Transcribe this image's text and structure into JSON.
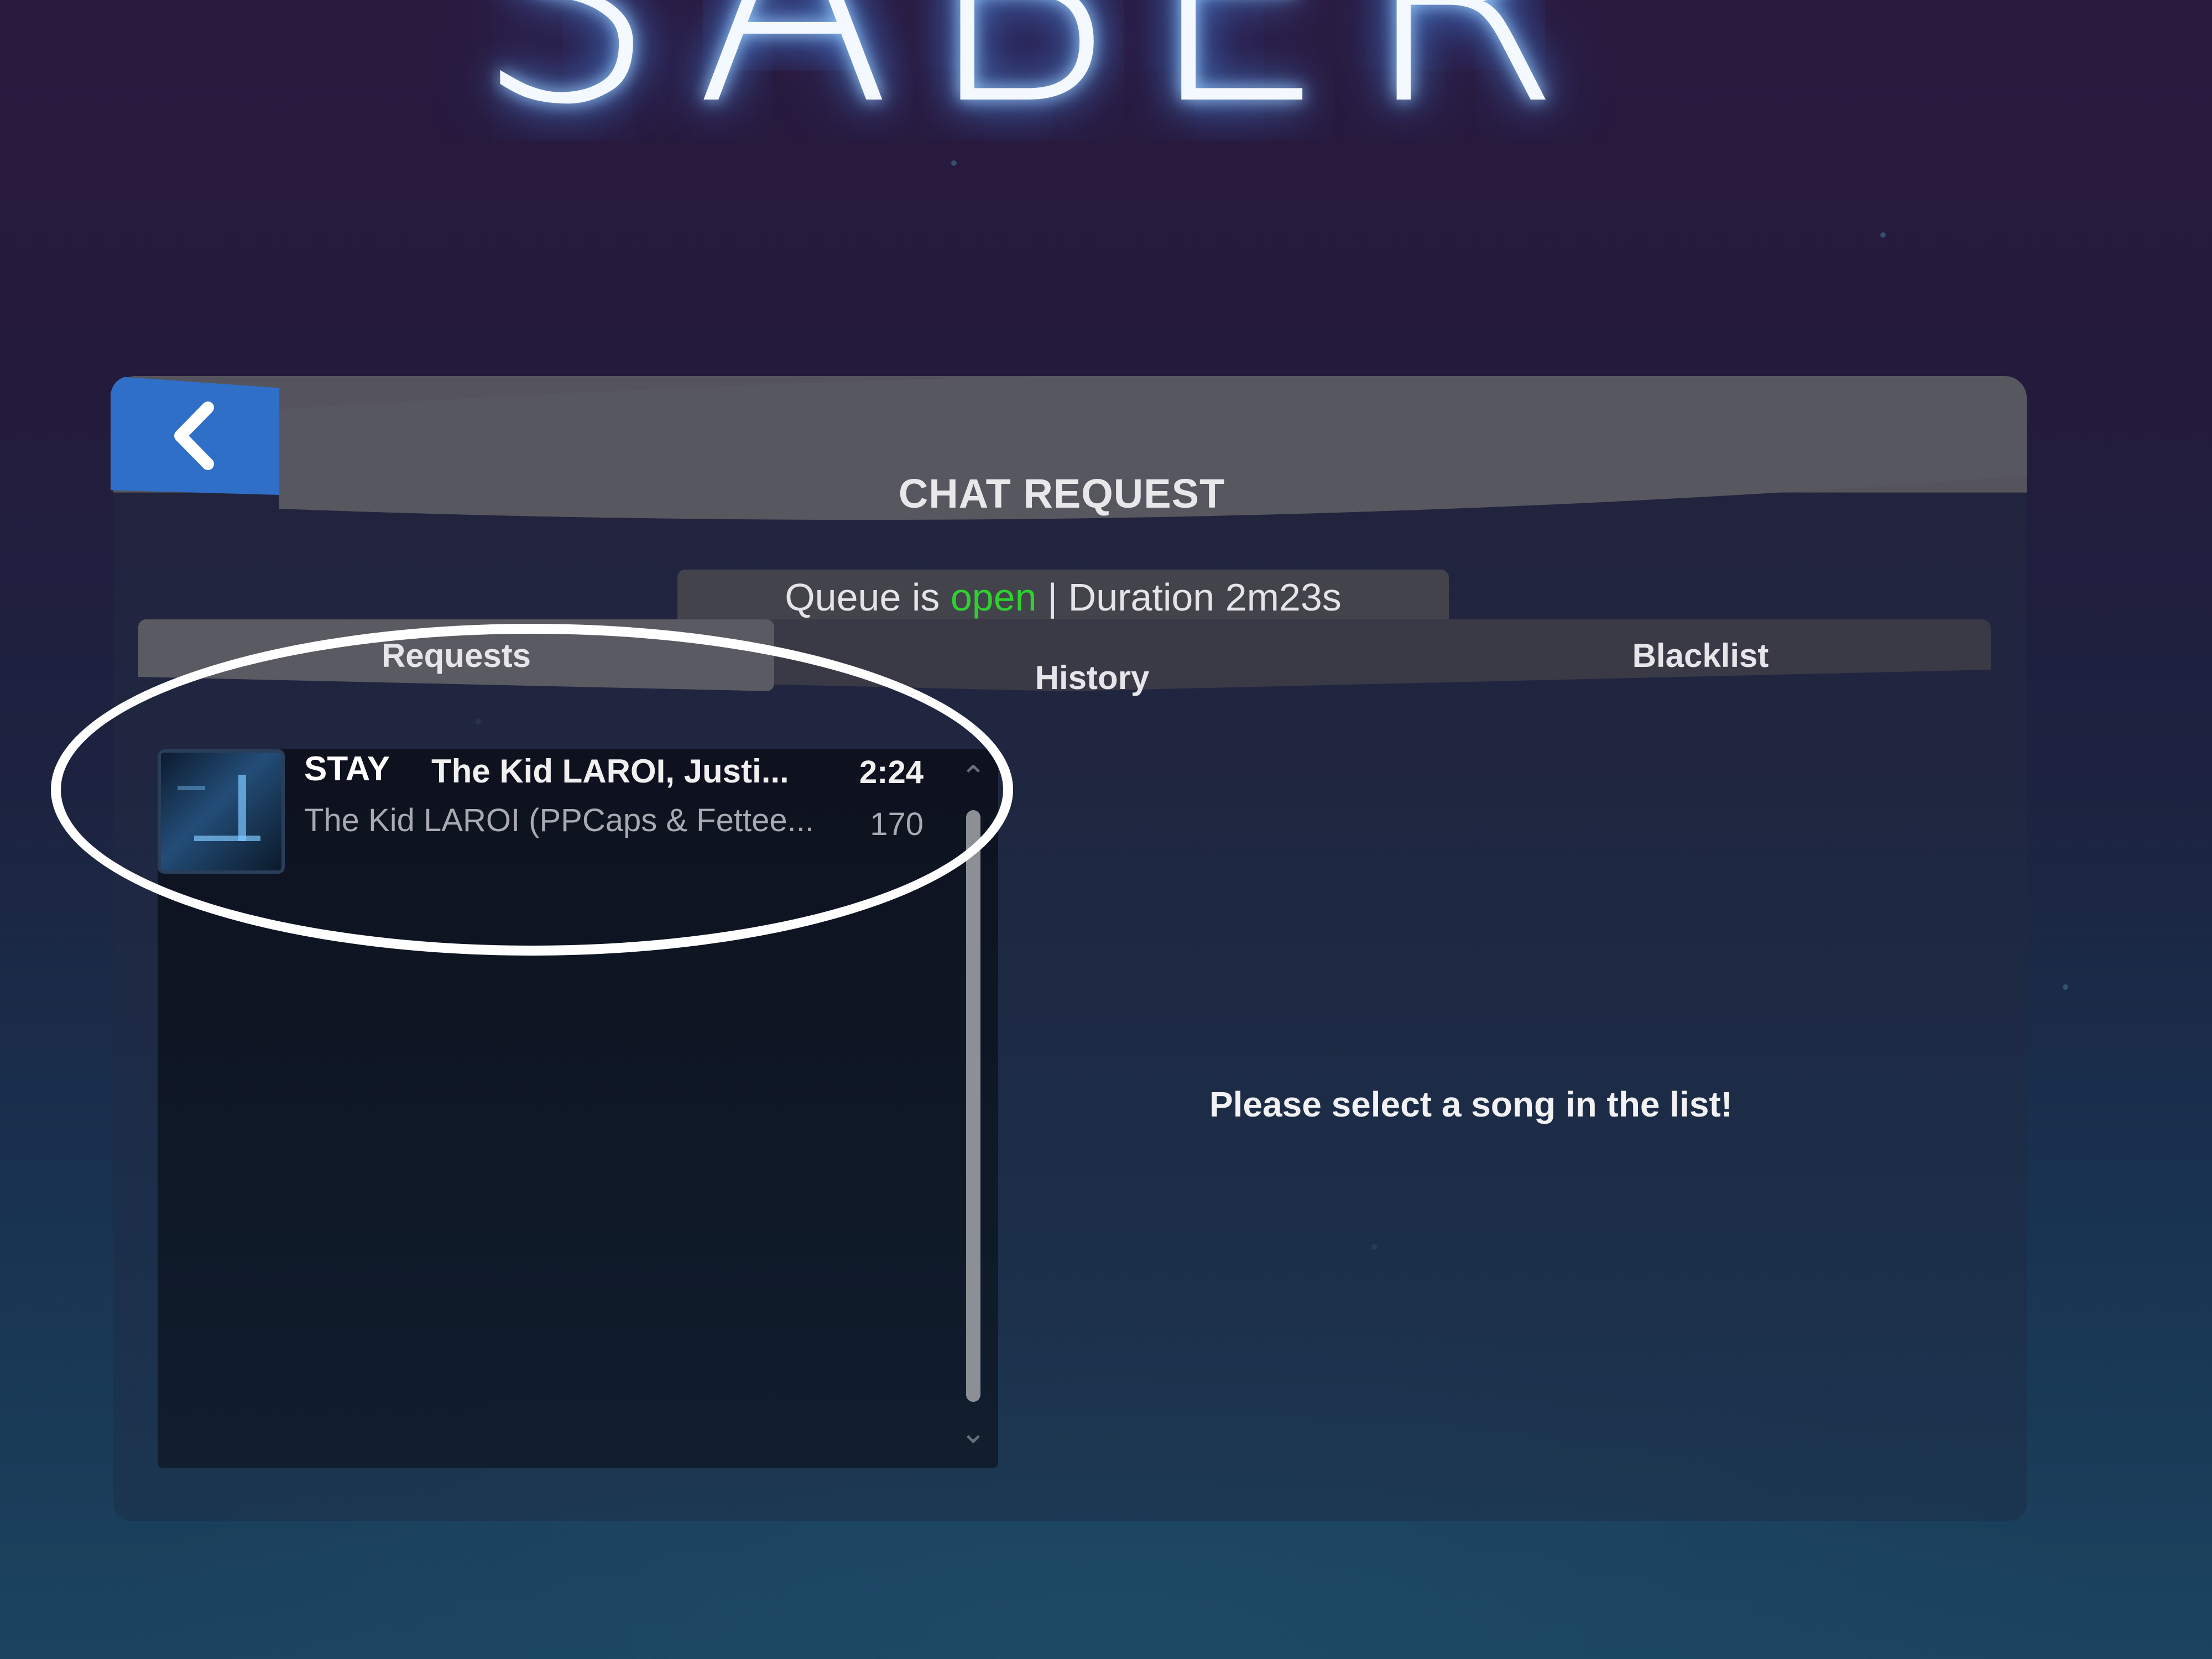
{
  "app": {
    "logo_text": "SABER"
  },
  "header": {
    "back_icon": "chevron-left-icon",
    "title": "CHAT REQUEST"
  },
  "status": {
    "prefix": "Queue is ",
    "state": "open",
    "suffix": " | Duration 2m23s",
    "state_color": "#2fd12f"
  },
  "tabs": [
    {
      "label": "Requests",
      "active": true
    },
    {
      "label": "History",
      "active": false
    },
    {
      "label": "Blacklist",
      "active": false
    }
  ],
  "requests": [
    {
      "title": "STAY",
      "artist": "The Kid LAROI, Justi...",
      "duration": "2:24",
      "mapper": "The Kid LAROI (PPCaps & Fettee...",
      "bpm": "170",
      "cover_icon": "album-cover-image"
    }
  ],
  "detail": {
    "empty_message": "Please select a song in the list!"
  },
  "colors": {
    "accent": "#2f6fc8",
    "panel_header": "#55545c"
  }
}
